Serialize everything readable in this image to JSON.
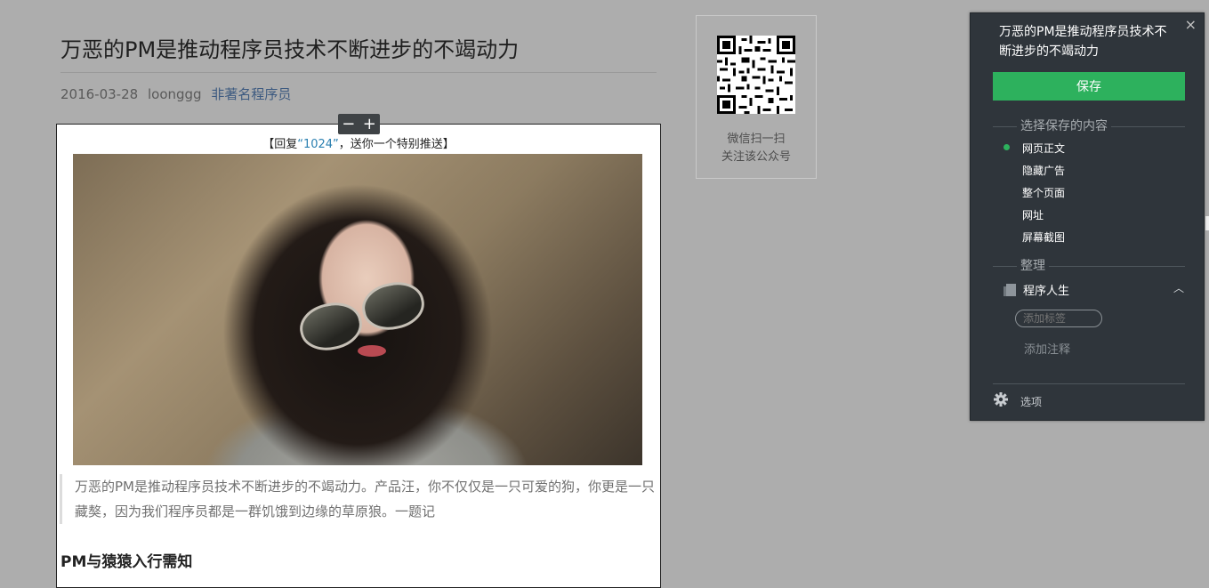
{
  "article": {
    "title": "万恶的PM是推动程序员技术不断进步的不竭动力",
    "date": "2016-03-28",
    "author": "loonggg",
    "account": "非著名程序员"
  },
  "zoom": {
    "minus": "−",
    "plus": "+"
  },
  "clip": {
    "promo_prefix": "【回复",
    "promo_keyword": "“1024”",
    "promo_suffix": "，送你一个特别推送】",
    "quote": "万恶的PM是推动程序员技术不断进步的不竭动力。产品汪，你不仅仅是一只可爱的狗，你更是一只藏獒，因为我们程序员都是一群饥饿到边缘的草原狼。一题记",
    "section_heading": "PM与猿猿入行需知"
  },
  "qr": {
    "line1": "微信扫一扫",
    "line2": "关注该公众号"
  },
  "panel": {
    "title": "万恶的PM是推动程序员技术不断进步的不竭动力",
    "close_icon": "×",
    "save_label": "保存",
    "section_content_label": "选择保存的内容",
    "options": [
      "网页正文",
      "隐藏广告",
      "整个页面",
      "网址",
      "屏幕截图"
    ],
    "selected_option": "网页正文",
    "section_organize_label": "整理",
    "notebook": "程序人生",
    "chevron": "︿",
    "tag_placeholder": "添加标签",
    "note_label": "添加注释",
    "options_label": "选项",
    "accent_color": "#2db15d",
    "background_color": "#2f353b"
  }
}
